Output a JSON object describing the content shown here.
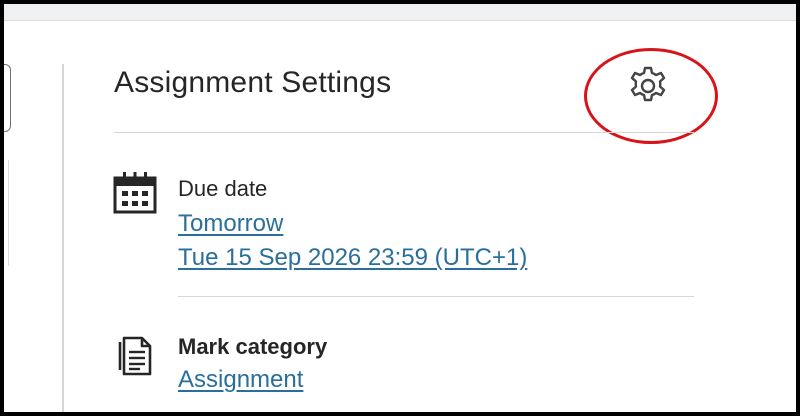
{
  "panel": {
    "title": "Assignment Settings",
    "settings_icon": "gear-icon"
  },
  "due_date": {
    "icon": "calendar-icon",
    "label": "Due date",
    "relative_link": "Tomorrow",
    "datetime_link": "Tue 15 Sep 2026 23:59 (UTC+1)"
  },
  "mark_category": {
    "icon": "document-icon",
    "label": "Mark category",
    "value_link": "Assignment"
  },
  "colors": {
    "link": "#2a6f9c",
    "text": "#262626",
    "highlight": "#d8141a"
  }
}
